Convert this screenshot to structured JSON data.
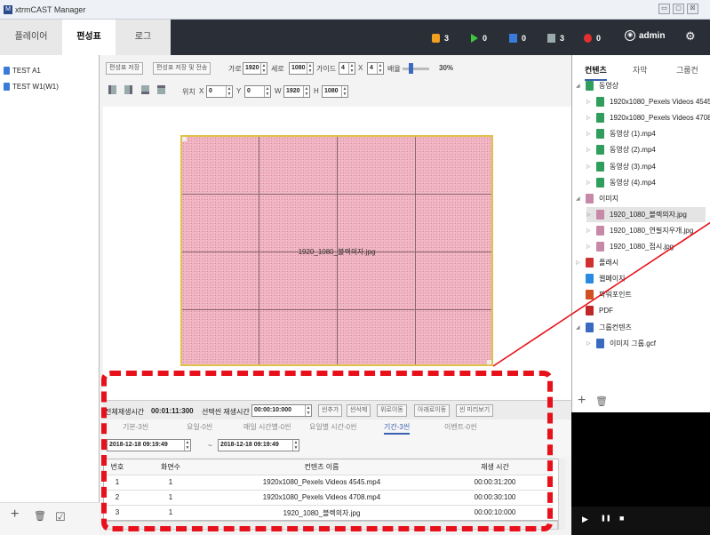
{
  "window": {
    "title": "xtrmCAST Manager",
    "app_icon": "M",
    "buttons": [
      "▭",
      "▢",
      "☒"
    ]
  },
  "tabs": [
    {
      "label": "플레이어"
    },
    {
      "label": "편성표"
    },
    {
      "label": "로그"
    }
  ],
  "status": [
    {
      "icon": "alert-count-icon",
      "value": "3",
      "color": "#f0a020"
    },
    {
      "icon": "play-icon",
      "value": "0",
      "color": "#3cc83c"
    },
    {
      "icon": "blue-square-icon",
      "value": "0",
      "color": "#3a7ad9"
    },
    {
      "icon": "gray-square-icon",
      "value": "3",
      "color": "#9aa"
    },
    {
      "icon": "error-icon",
      "value": "0",
      "color": "#e23030"
    }
  ],
  "user": {
    "name": "admin"
  },
  "schedules": [
    {
      "label": "TEST A1"
    },
    {
      "label": "TEST W1(W1)"
    }
  ],
  "left_bottom": {
    "add": "+",
    "delete": "🗑",
    "edit": "☑"
  },
  "toolbar": {
    "save": "편성표 저장",
    "save_send": "편성표 저장 및 전송",
    "width_label": "가로",
    "width": "1920",
    "height_label": "세로",
    "height": "1080",
    "guide_label": "가이드",
    "guide_x": "4",
    "x_sep": "X",
    "guide_y": "4",
    "zoom_label": "배율",
    "zoom": "30%",
    "pos_label": "위치",
    "x_label": "X",
    "x": "0",
    "y_label": "Y",
    "y": "0",
    "w_label": "W",
    "w": "1920",
    "h_label": "H",
    "h": "1080"
  },
  "canvas": {
    "label": "1920_1080_블렉의자.jpg",
    "color": "#f1b7c4"
  },
  "playback": {
    "total_label": "전체재생시간",
    "total": "00:01:11:300",
    "sel_label": "선택씬 재생시간",
    "sel": "00:00:10:000",
    "btns": [
      "씬추가",
      "씬삭제",
      "위로이동",
      "아래로이동",
      "씬 미리보기"
    ]
  },
  "subtabs": [
    {
      "label": "기본-3씬"
    },
    {
      "label": "요일-0씬"
    },
    {
      "label": "매일 시간별-0씬"
    },
    {
      "label": "요일별 시간-0씬"
    },
    {
      "label": "기간-3씬"
    },
    {
      "label": "이벤트-0씬"
    }
  ],
  "date": {
    "from": "2018-12-18 09:19:49",
    "sep": "~",
    "to": "2018-12-18 09:19:49"
  },
  "table": {
    "headers": [
      "번호",
      "화면수",
      "컨텐츠 이름",
      "재생 시간"
    ],
    "rows": [
      [
        "1",
        "1",
        "1920x1080_Pexels Videos 4545.mp4",
        "00:00:31:200"
      ],
      [
        "2",
        "1",
        "1920x1080_Pexels Videos 4708.mp4",
        "00:00:30:100"
      ],
      [
        "3",
        "1",
        "1920_1080_블렉의자.jpg",
        "00:00:10:000"
      ]
    ]
  },
  "right_tabs": [
    {
      "label": "컨텐츠"
    },
    {
      "label": "자막"
    },
    {
      "label": "그룹컨"
    }
  ],
  "content_tree": [
    {
      "label": "동영상",
      "type": "folder",
      "color": "#2f9e5c",
      "level": 0,
      "open": true
    },
    {
      "label": "1920x1080_Pexels Videos 4545...",
      "type": "file",
      "color": "#2f9e5c",
      "level": 1
    },
    {
      "label": "1920x1080_Pexels Videos 4708...",
      "type": "file",
      "color": "#2f9e5c",
      "level": 1
    },
    {
      "label": "동영상 (1).mp4",
      "type": "file",
      "color": "#2f9e5c",
      "level": 1
    },
    {
      "label": "동영상 (2).mp4",
      "type": "file",
      "color": "#2f9e5c",
      "level": 1
    },
    {
      "label": "동영상 (3).mp4",
      "type": "file",
      "color": "#2f9e5c",
      "level": 1
    },
    {
      "label": "동영상 (4).mp4",
      "type": "file",
      "color": "#2f9e5c",
      "level": 1
    },
    {
      "label": "이미지",
      "type": "folder",
      "color": "#c888a8",
      "level": 0,
      "open": true
    },
    {
      "label": "1920_1080_블렉의자.jpg",
      "type": "file",
      "color": "#c888a8",
      "level": 1,
      "selected": true
    },
    {
      "label": "1920_1080_연필지우개.jpg",
      "type": "file",
      "color": "#c888a8",
      "level": 1
    },
    {
      "label": "1920_1080_접시.jpg",
      "type": "file",
      "color": "#c888a8",
      "level": 1
    },
    {
      "label": "플래시",
      "type": "folder",
      "color": "#d03030",
      "level": 0,
      "open": false
    },
    {
      "label": "웹페이지",
      "type": "file",
      "color": "#2a8ae0",
      "level": 0
    },
    {
      "label": "파워포인트",
      "type": "file",
      "color": "#d05020",
      "level": 0
    },
    {
      "label": "PDF",
      "type": "file",
      "color": "#c02828",
      "level": 0
    },
    {
      "label": "그룹컨텐츠",
      "type": "folder",
      "color": "#3a6ac0",
      "level": 0,
      "open": true
    },
    {
      "label": "이미지 그룹.gcf",
      "type": "file",
      "color": "#3a6ac0",
      "level": 1
    }
  ],
  "preview_controls": [
    "▶",
    "❚❚",
    "■"
  ],
  "highlight_color": "#e8101a"
}
